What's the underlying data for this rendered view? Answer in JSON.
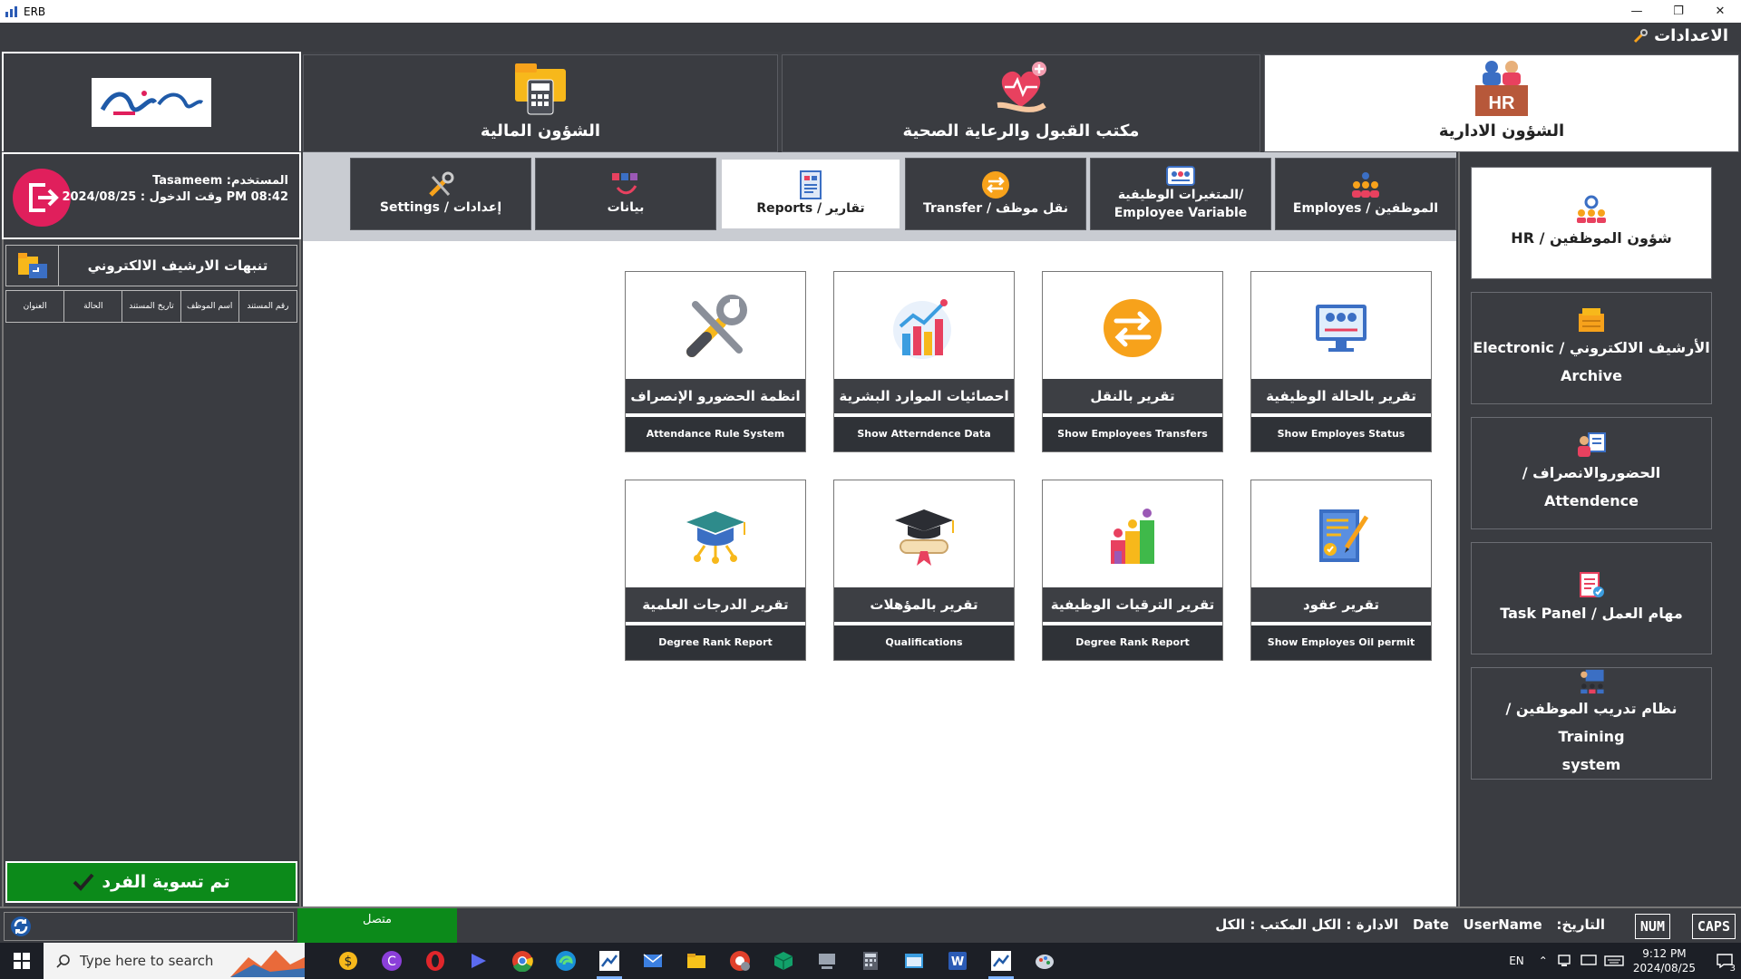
{
  "window": {
    "title": "ERB",
    "minimize": "—",
    "restore": "❐",
    "close": "✕"
  },
  "settings_bar": {
    "label": "الاعدادات"
  },
  "modules": [
    {
      "label": "الشؤون المالية",
      "icon": "calculator-folder-icon"
    },
    {
      "label": "مكتب القبول والرعاية الصحية",
      "icon": "health-heart-icon"
    },
    {
      "label": "الشؤون الادارية",
      "icon": "hr-office-icon",
      "active": true
    }
  ],
  "user": {
    "line1": "Tasameem :المستخدم",
    "line2": "وقت الدخول : 2024/08/25 PM 08:42"
  },
  "archive_alerts": {
    "title": "تنبهات الارشيف الالكتروني",
    "columns": [
      "رقم المستند",
      "اسم الموظف",
      "تاريخ المستند",
      "الحالة",
      "العنوان"
    ]
  },
  "settle_button": {
    "label": "تم تسوية الفرد"
  },
  "subtabs": [
    {
      "label": "Settings / إعدادات",
      "icon": "tools-icon"
    },
    {
      "label": "بيانات",
      "icon": "data-icon"
    },
    {
      "label": "Reports / تقارير",
      "icon": "report-icon",
      "active": true
    },
    {
      "label": "Transfer / نقل موظف",
      "icon": "transfer-icon"
    },
    {
      "label": "المتغيرات الوظيفية/ Employee Variable",
      "icon": "variables-icon"
    },
    {
      "label": "Employes / الموظفين",
      "icon": "employees-icon"
    }
  ],
  "cards": [
    {
      "ar": "انظمة الحضورو الإنصراف",
      "en": "Attendance Rule System",
      "icon": "tools-icon"
    },
    {
      "ar": "احصائيات الموارد البشرية",
      "en": "Show Atterndence Data",
      "icon": "statistics-icon"
    },
    {
      "ar": "تقرير بالنقل",
      "en": "Show Employees Transfers",
      "icon": "transfer-icon"
    },
    {
      "ar": "تقرير بالحالة الوظيفية",
      "en": "Show Employes Status",
      "icon": "monitor-status-icon"
    },
    {
      "ar": "تقرير الدرجات العلمية",
      "en": "Degree Rank Report",
      "icon": "graduation-network-icon"
    },
    {
      "ar": "تقرير بالمؤهلات",
      "en": "Qualifications",
      "icon": "graduation-diploma-icon"
    },
    {
      "ar": "تقرير الترقيات الوظيفية",
      "en": "Degree Rank Report",
      "icon": "promotion-icon"
    },
    {
      "ar": "تقرير عقود",
      "en": "Show Employes Oil permit",
      "icon": "contract-icon"
    }
  ],
  "sidebar": [
    {
      "label1": "شؤون الموظفين / HR",
      "label2": "",
      "icon": "hr-gear-icon",
      "active": true
    },
    {
      "label1": "الأرشيف الالكتروني / Electronic",
      "label2": "Archive",
      "icon": "archive-icon"
    },
    {
      "label1": "الحضوروالانصراف /",
      "label2": "Attendence",
      "icon": "attendance-icon"
    },
    {
      "label1": "مهام العمل / Task Panel",
      "label2": "",
      "icon": "task-icon"
    },
    {
      "label1": "نظام تدريب الموظفين / Training",
      "label2": "system",
      "icon": "training-icon"
    }
  ],
  "status_bar": {
    "connected": "متصل",
    "info": "التاريخ:   Date   UserName   الادارة : الكل المكتب : الكل",
    "num": "NUM",
    "caps": "CAPS"
  },
  "taskbar": {
    "search_placeholder": "Type here to search",
    "language": "EN",
    "time": "9:12 PM",
    "date": "2024/08/25",
    "notification_count": "3"
  },
  "colors": {
    "panel": "#3a3c41",
    "accent_green": "#0c8a1a",
    "logout_pink": "#e01f5c",
    "orange": "#f7a21b"
  }
}
